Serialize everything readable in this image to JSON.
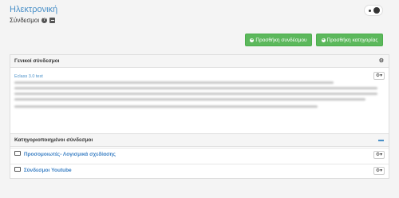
{
  "header": {
    "title": "Ηλεκτρονική",
    "subtitle": "Σύνδεσμοι",
    "help_glyph": "?"
  },
  "toolbar": {
    "add_link": "Προσθήκη συνδέσμου",
    "add_category": "Προσθήκη κατηγορίας"
  },
  "general_panel": {
    "title": "Γενικοί σύνδεσμοι",
    "item_link": "Eclass 3.0 test"
  },
  "category_panel": {
    "title": "Κατηγοριοποιημένοι σύνδεσμοι",
    "categories": [
      {
        "label": "Προσομοιωτές- Λογισμικά σχεδίασης"
      },
      {
        "label": "Σύνδεσμοι Youtube"
      }
    ]
  },
  "icons": {
    "gear": "gear-icon",
    "caret": "caret-down-icon",
    "folder": "folder-icon",
    "folder_open": "folder-open-icon",
    "cogs": "cogs-icon"
  },
  "colors": {
    "accent": "#4a90c8",
    "success": "#5cb85c"
  }
}
